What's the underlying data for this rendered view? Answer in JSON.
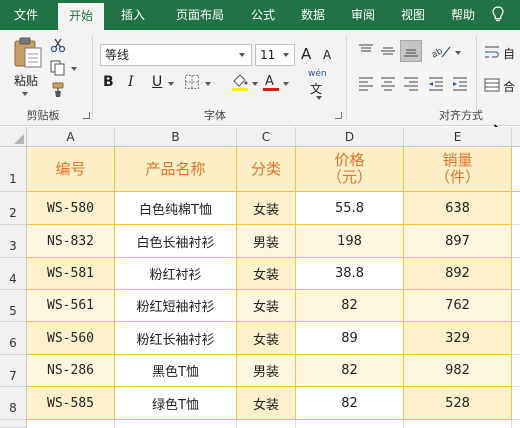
{
  "menu": {
    "tabs": [
      "文件",
      "开始",
      "插入",
      "页面布局",
      "公式",
      "数据",
      "审阅",
      "视图",
      "帮助"
    ],
    "active": "开始"
  },
  "ribbon": {
    "clipboard": {
      "paste_label": "粘贴",
      "group_label": "剪贴板"
    },
    "font": {
      "font_name": "等线",
      "font_size": "11",
      "group_label": "字体",
      "bold": "B",
      "italic": "I",
      "underline": "U",
      "grow": "A",
      "shrink": "A",
      "phonetic_top": "wén",
      "phonetic_bottom": "文"
    },
    "alignment": {
      "group_label": "对齐方式",
      "wrap_label": "自",
      "merge_label": "合"
    }
  },
  "sheet": {
    "columns": [
      "A",
      "B",
      "C",
      "D",
      "E"
    ],
    "rows": [
      "1",
      "2",
      "3",
      "4",
      "5",
      "6",
      "7",
      "8"
    ],
    "headers": [
      {
        "line1": "编号",
        "line2": ""
      },
      {
        "line1": "产品名称",
        "line2": ""
      },
      {
        "line1": "分类",
        "line2": ""
      },
      {
        "line1": "价格",
        "line2": "（元）"
      },
      {
        "line1": "销量",
        "line2": "（件）"
      }
    ],
    "data": [
      [
        "WS-580",
        "白色纯棉T恤",
        "女装",
        "55.8",
        "638"
      ],
      [
        "NS-832",
        "白色长袖衬衫",
        "男装",
        "198",
        "897"
      ],
      [
        "WS-581",
        "粉红衬衫",
        "女装",
        "38.8",
        "892"
      ],
      [
        "WS-561",
        "粉红短袖衬衫",
        "女装",
        "82",
        "762"
      ],
      [
        "WS-560",
        "粉红长袖衬衫",
        "女装",
        "89",
        "329"
      ],
      [
        "NS-286",
        "黑色T恤",
        "男装",
        "82",
        "982"
      ],
      [
        "WS-585",
        "绿色T恤",
        "女装",
        "82",
        "528"
      ]
    ]
  },
  "colors": {
    "accent": "#217346",
    "grid_border": "#f5c542",
    "header_text": "#e4732b",
    "band_a": "#fdf1cc",
    "band_b": "#fef7e0"
  }
}
